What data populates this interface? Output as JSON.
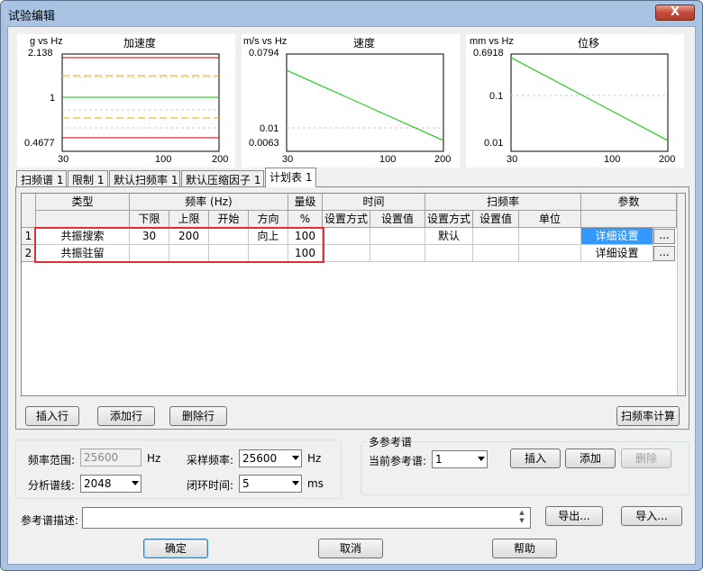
{
  "window": {
    "title": "试验编辑",
    "close_label": "X"
  },
  "charts": [
    {
      "title": "加速度",
      "unit": "g vs Hz",
      "y_labels": [
        "2.138",
        "1",
        "0.4677"
      ],
      "x_labels": [
        "30",
        "100",
        "200"
      ]
    },
    {
      "title": "速度",
      "unit": "m/s vs Hz",
      "y_labels": [
        "0.0794",
        "0.01",
        "0.0063"
      ],
      "x_labels": [
        "30",
        "100",
        "200"
      ]
    },
    {
      "title": "位移",
      "unit": "mm vs Hz",
      "y_labels": [
        "0.6918",
        "0.1",
        "0.01"
      ],
      "x_labels": [
        "30",
        "100",
        "200"
      ]
    }
  ],
  "colors": {
    "limit_red": "#d00000",
    "alarm_orange": "#e8a800",
    "reference_green": "#00cc00",
    "highlight_red": "#e03030",
    "selected_blue": "#3399ff"
  },
  "tabs": [
    "扫频谱 1",
    "限制 1",
    "默认扫频率 1",
    "默认压缩因子 1",
    "计划表 1"
  ],
  "table": {
    "headers_top": {
      "type": "类型",
      "freq": "频率 (Hz)",
      "level": "量级",
      "time": "时间",
      "sweep": "扫频率",
      "params": "参数"
    },
    "headers_sub": {
      "lower": "下限",
      "upper": "上限",
      "start": "开始",
      "direction": "方向",
      "percent": "%",
      "time_mode": "设置方式",
      "time_value": "设置值",
      "sweep_mode": "设置方式",
      "sweep_value": "设置值",
      "unit": "单位"
    },
    "rows": [
      {
        "num": "1",
        "type": "共振搜索",
        "lower": "30",
        "upper": "200",
        "start": "",
        "direction": "向上",
        "level": "100",
        "time_mode": "",
        "time_value": "",
        "sweep_mode": "默认",
        "sweep_value": "",
        "unit": "",
        "params": "详细设置",
        "more": "..."
      },
      {
        "num": "2",
        "type": "共振驻留",
        "lower": "",
        "upper": "",
        "start": "",
        "direction": "",
        "level": "100",
        "time_mode": "",
        "time_value": "",
        "sweep_mode": "",
        "sweep_value": "",
        "unit": "",
        "params": "详细设置",
        "more": "..."
      }
    ]
  },
  "table_buttons": {
    "insert_row": "插入行",
    "add_row": "添加行",
    "delete_row": "删除行",
    "sweep_calc": "扫频率计算"
  },
  "settings": {
    "freq_range_label": "频率范围:",
    "freq_range_value": "25600",
    "freq_range_unit": "Hz",
    "sample_rate_label": "采样频率:",
    "sample_rate_value": "25600",
    "sample_rate_unit": "Hz",
    "lines_label": "分析谱线:",
    "lines_value": "2048",
    "loop_time_label": "闭环时间:",
    "loop_time_value": "5",
    "loop_time_unit": "ms"
  },
  "multi_ref": {
    "group_title": "多参考谱",
    "current_label": "当前参考谱:",
    "current_value": "1",
    "insert": "插入",
    "add": "添加",
    "delete": "删除"
  },
  "ref_desc": {
    "label": "参考谱描述:",
    "value": "",
    "export": "导出...",
    "import": "导入..."
  },
  "footer": {
    "ok": "确定",
    "cancel": "取消",
    "help": "帮助"
  }
}
